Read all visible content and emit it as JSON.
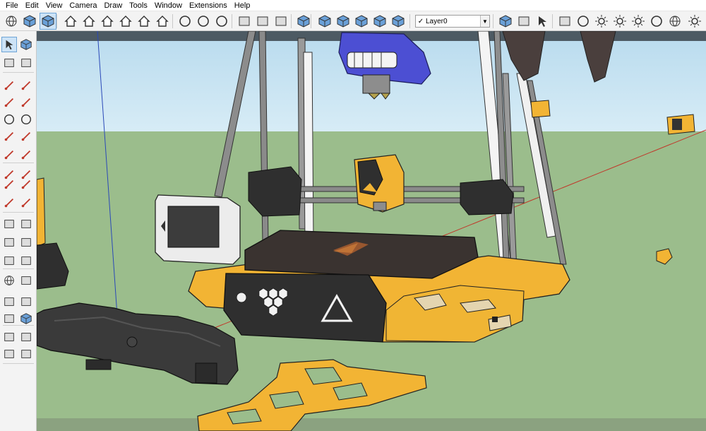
{
  "menu": {
    "items": [
      "File",
      "Edit",
      "View",
      "Camera",
      "Draw",
      "Tools",
      "Window",
      "Extensions",
      "Help"
    ]
  },
  "toolbar": {
    "layer": {
      "current": "Layer0",
      "check": "✓"
    }
  },
  "icons": {
    "top": [
      "orbit-icon",
      "component-icon",
      "component-3d-icon",
      "warehouse-icon",
      "door-icon",
      "home-icon",
      "house-icon",
      "house-outline-icon",
      "shop-icon",
      "vray-logo-icon",
      "teapot-icon",
      "teapot-render-icon",
      "frame-buffer-icon",
      "render-window-icon",
      "lock-render-icon",
      "layers-icon",
      "iso-view-icon",
      "top-view-icon",
      "front-view-icon",
      "right-view-icon",
      "back-view-icon",
      "layer-manager-icon",
      "tag-icon",
      "download-icon",
      "graduation-icon",
      "sphere-light-icon",
      "cone-light-icon",
      "spot-light-icon",
      "sun-icon",
      "dome-icon",
      "globe-icon",
      "lightbulb-icon"
    ],
    "left": [
      "select-icon",
      "component-make-icon",
      "paint-bucket-icon",
      "eraser-icon",
      "pencil-icon",
      "freehand-icon",
      "rectangle-icon",
      "rotated-rectangle-icon",
      "circle-icon",
      "polygon-icon",
      "arc-icon",
      "two-point-arc-icon",
      "three-point-arc-icon",
      "pie-icon",
      "move-icon",
      "push-pull-icon",
      "rotate-icon",
      "follow-me-icon",
      "scale-icon",
      "offset-icon",
      "tape-measure-icon",
      "dimension-icon",
      "protractor-icon",
      "text-icon",
      "axes-icon",
      "3d-text-icon",
      "orbit-tool-icon",
      "pan-icon",
      "zoom-icon",
      "zoom-window-icon",
      "zoom-extents-icon",
      "previous-view-icon",
      "walk-icon",
      "look-around-icon",
      "footprints-icon",
      "position-camera-icon"
    ]
  },
  "colors": {
    "sky": "#d0e8f4",
    "ground": "#9bbd8c",
    "printer_orange": "#f2b434",
    "printer_black": "#2f2f2f",
    "hotend_blue": "#4c4fd3",
    "axis_red": "#c0392b",
    "axis_blue": "#2a48b8"
  }
}
